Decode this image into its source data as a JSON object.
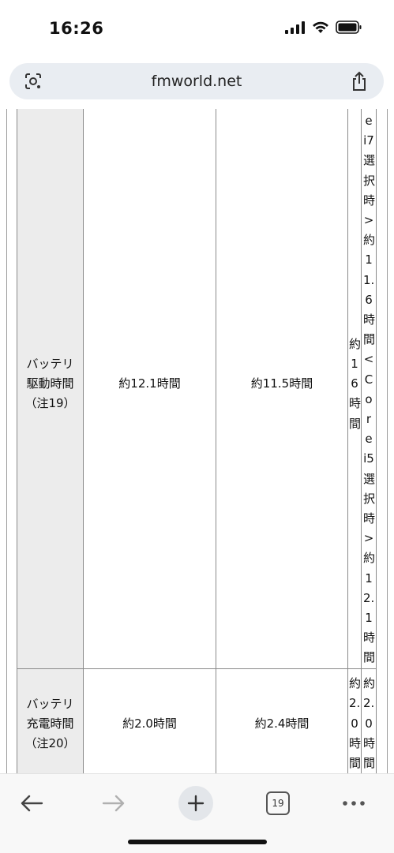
{
  "status_bar": {
    "time": "16:26"
  },
  "browser": {
    "url": "fmworld.net",
    "tab_count": "19"
  },
  "table": {
    "rows": [
      {
        "header": [
          "バッテリ",
          "駆動時間",
          "（注19）"
        ],
        "col1": "約12.1時間",
        "col2": "約11.5時間",
        "col3": "約16時間",
        "col4": "e i7選択時>約11.6時間<Core i5選択時>約12.1時間"
      },
      {
        "header": [
          "バッテリ",
          "充電時間",
          "（注20）"
        ],
        "col1": "約2.0時間",
        "col2": "約2.4時間",
        "col3": "約2.0時間",
        "col4": "約2.0時間"
      }
    ]
  }
}
